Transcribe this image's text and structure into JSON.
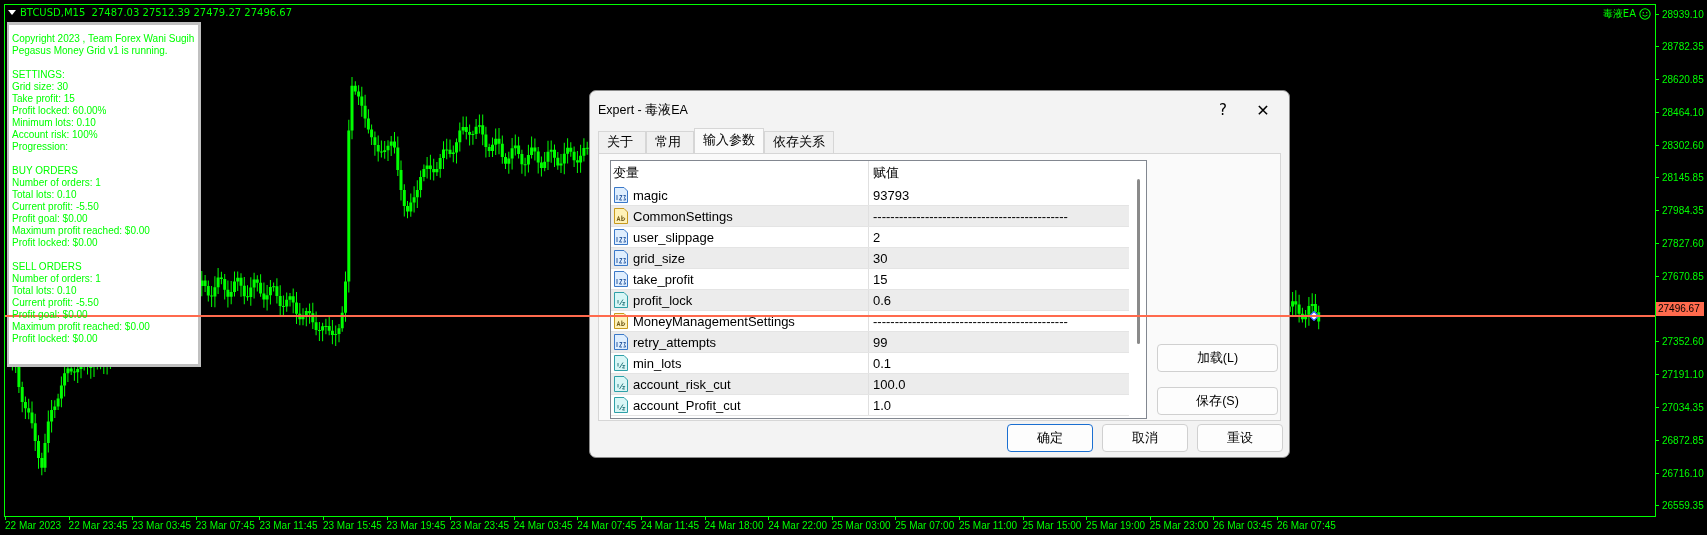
{
  "chart": {
    "title": "BTCUSD,M15  27487.03 27512.39 27479.27 27496.67",
    "ea_label": "毒液EA",
    "price_labels": [
      {
        "label": "28939.10",
        "current": false
      },
      {
        "label": "28782.35",
        "current": false
      },
      {
        "label": "28620.85",
        "current": false
      },
      {
        "label": "28464.10",
        "current": false
      },
      {
        "label": "28302.60",
        "current": false
      },
      {
        "label": "28145.85",
        "current": false
      },
      {
        "label": "27984.35",
        "current": false
      },
      {
        "label": "27827.60",
        "current": false
      },
      {
        "label": "27670.85",
        "current": false
      },
      {
        "label": "27496.67",
        "current": true
      },
      {
        "label": "27352.60",
        "current": false
      },
      {
        "label": "27191.10",
        "current": false
      },
      {
        "label": "27034.35",
        "current": false
      },
      {
        "label": "26872.85",
        "current": false
      },
      {
        "label": "26716.10",
        "current": false
      },
      {
        "label": "26559.35",
        "current": false
      }
    ],
    "time_labels": [
      "22 Mar 2023",
      "22 Mar 23:45",
      "23 Mar 03:45",
      "23 Mar 07:45",
      "23 Mar 11:45",
      "23 Mar 15:45",
      "23 Mar 19:45",
      "23 Mar 23:45",
      "24 Mar 03:45",
      "24 Mar 07:45",
      "24 Mar 11:45",
      "24 Mar 18:00",
      "24 Mar 22:00",
      "25 Mar 03:00",
      "25 Mar 07:00",
      "25 Mar 11:00",
      "25 Mar 15:00",
      "25 Mar 19:00",
      "25 Mar 23:00",
      "26 Mar 03:45",
      "26 Mar 07:45"
    ]
  },
  "info_panel": {
    "sections": [
      [
        "Copyright 2023 , Team Forex Wani Sugih",
        "Pegasus Money Grid v1 is running."
      ],
      [
        "SETTINGS:",
        "Grid size: 30",
        "Take profit: 15",
        "Profit locked: 60.00%",
        "Minimum lots: 0.10",
        "Account risk: 100%",
        "Progression:"
      ],
      [
        "BUY ORDERS",
        "Number of orders: 1",
        "Total lots: 0.10",
        "Current profit: -5.50",
        "Profit goal: $0.00",
        "Maximum profit reached: $0.00",
        "Profit locked: $0.00"
      ],
      [
        "SELL ORDERS",
        "Number of orders: 1",
        "Total lots: 0.10",
        "Current profit: -5.50",
        "Profit goal: $0.00",
        "Maximum profit reached: $0.00",
        "Profit locked: $0.00"
      ]
    ]
  },
  "dialog": {
    "title": "Expert - 毒液EA",
    "help": "?",
    "close": "✕",
    "tabs": [
      {
        "label": "关于",
        "selected": false
      },
      {
        "label": "常用",
        "selected": false
      },
      {
        "label": "输入参数",
        "selected": true
      },
      {
        "label": "依存关系",
        "selected": false
      }
    ],
    "table": {
      "columns": [
        "变量",
        "赋值"
      ],
      "rows": [
        {
          "kind": "int",
          "name": "magic",
          "value": "93793"
        },
        {
          "kind": "string",
          "name": "CommonSettings",
          "value": "---------------------------------------------"
        },
        {
          "kind": "int",
          "name": "user_slippage",
          "value": "2"
        },
        {
          "kind": "int",
          "name": "grid_size",
          "value": "30"
        },
        {
          "kind": "int",
          "name": "take_profit",
          "value": "15"
        },
        {
          "kind": "double",
          "name": "profit_lock",
          "value": "0.6"
        },
        {
          "kind": "string",
          "name": "MoneyManagementSettings",
          "value": "---------------------------------------------"
        },
        {
          "kind": "int",
          "name": "retry_attempts",
          "value": "99"
        },
        {
          "kind": "double",
          "name": "min_lots",
          "value": "0.1"
        },
        {
          "kind": "double",
          "name": "account_risk_cut",
          "value": "100.0"
        },
        {
          "kind": "double",
          "name": "account_Profit_cut",
          "value": "1.0"
        }
      ]
    },
    "side_buttons": [
      "加载(L)",
      "保存(S)"
    ],
    "buttons": [
      {
        "label": "确定",
        "default": true
      },
      {
        "label": "取消",
        "default": false
      },
      {
        "label": "重设",
        "default": false
      }
    ]
  }
}
